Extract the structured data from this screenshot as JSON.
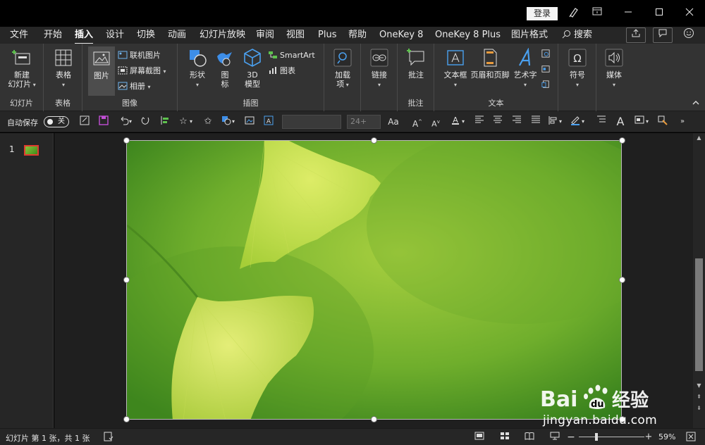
{
  "titlebar": {
    "login_label": "登录",
    "icons": [
      "pen-icon",
      "ribbon-display-icon",
      "minimize-icon",
      "maximize-icon",
      "close-icon"
    ]
  },
  "menu": {
    "tabs": [
      "文件",
      "开始",
      "插入",
      "设计",
      "切换",
      "动画",
      "幻灯片放映",
      "审阅",
      "视图",
      "Plus",
      "帮助",
      "OneKey 8",
      "OneKey 8 Plus",
      "图片格式"
    ],
    "active_tab": "插入",
    "search_label": "搜索"
  },
  "ribbon": {
    "slides": {
      "new_slide": "新建\n幻灯片",
      "group": "幻灯片"
    },
    "tables": {
      "table": "表格",
      "group": "表格"
    },
    "images": {
      "picture": "图片",
      "online_picture": "联机图片",
      "screenshot": "屏幕截图",
      "album": "相册",
      "group": "图像"
    },
    "illustrations": {
      "shapes": "形状",
      "icons": "图\n标",
      "model3d": "3D\n模型",
      "smartart": "SmartArt",
      "chart": "图表",
      "group": "插图"
    },
    "addins": {
      "label": "加载\n项"
    },
    "links": {
      "label": "链接"
    },
    "comments": {
      "comment": "批注",
      "group": "批注"
    },
    "text": {
      "textbox": "文本框",
      "header_footer": "页眉和页脚",
      "wordart": "艺术字",
      "group": "文本"
    },
    "symbols": {
      "label": "符号"
    },
    "media": {
      "label": "媒体"
    }
  },
  "toolbar": {
    "autosave_label": "自动保存",
    "autosave_state": "关",
    "font_size": "24+"
  },
  "slides": {
    "current_number": "1"
  },
  "statusbar": {
    "slide_info": "幻灯片 第 1 张，共 1 张",
    "zoom": "59%",
    "zoom_fraction": 0.59
  },
  "watermark": {
    "logo_text": "Baidu经验",
    "url": "jingyan.baidu.com"
  }
}
